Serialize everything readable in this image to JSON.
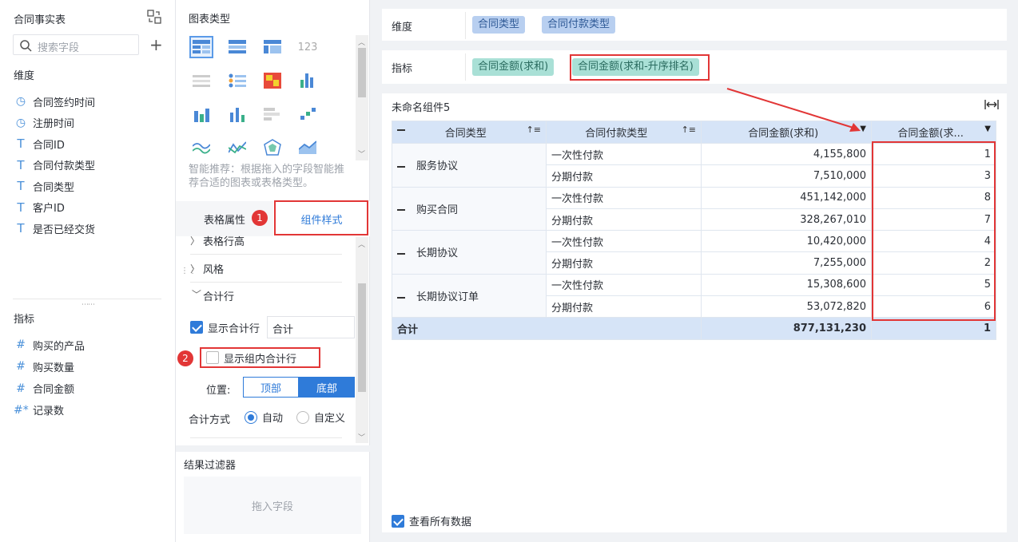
{
  "left": {
    "title": "合同事实表",
    "search_placeholder": "搜索字段",
    "dim_header": "维度",
    "dimensions": [
      {
        "icon": "clock-icon",
        "label": "合同签约时间"
      },
      {
        "icon": "clock-icon",
        "label": "注册时间"
      },
      {
        "icon": "text-icon",
        "label": "合同ID"
      },
      {
        "icon": "text-icon",
        "label": "合同付款类型"
      },
      {
        "icon": "text-icon",
        "label": "合同类型"
      },
      {
        "icon": "text-icon",
        "label": "客户ID"
      },
      {
        "icon": "text-icon",
        "label": "是否已经交货"
      }
    ],
    "met_header": "指标",
    "metrics": [
      {
        "icon": "hash-icon",
        "label": "购买的产品"
      },
      {
        "icon": "hash-icon",
        "label": "购买数量"
      },
      {
        "icon": "hash-icon",
        "label": "合同金额"
      },
      {
        "icon": "hash-star-icon",
        "label": "记录数"
      }
    ]
  },
  "mid": {
    "chart_type_title": "图表类型",
    "smart_hint": "智能推荐：根据拖入的字段智能推荐合适的图表或表格类型。",
    "tab_table_props": "表格属性",
    "tab_component_style": "组件样式",
    "badge1": "1",
    "badge2": "2",
    "row_height": "表格行高",
    "style": "风格",
    "total_row": "合计行",
    "show_total": "显示合计行",
    "total_name": "合计",
    "show_group_total": "显示组内合计行",
    "position_label": "位置:",
    "pos_top": "顶部",
    "pos_bottom": "底部",
    "total_method_label": "合计方式",
    "auto": "自动",
    "custom": "自定义",
    "result_filter": "结果过滤器",
    "drag_field": "拖入字段"
  },
  "right": {
    "dim_label": "维度",
    "dim_pills": [
      "合同类型",
      "合同付款类型"
    ],
    "met_label": "指标",
    "met_pills": [
      "合同金额(求和)",
      "合同金额(求和-升序排名)"
    ],
    "component_title": "未命名组件5",
    "view_all": "查看所有数据",
    "table": {
      "headers": [
        "合同类型",
        "合同付款类型",
        "合同金额(求和)",
        "合同金额(求..."
      ],
      "groups": [
        {
          "name": "服务协议",
          "rows": [
            [
              "一次性付款",
              "4,155,800",
              "1"
            ],
            [
              "分期付款",
              "7,510,000",
              "3"
            ]
          ]
        },
        {
          "name": "购买合同",
          "rows": [
            [
              "一次性付款",
              "451,142,000",
              "8"
            ],
            [
              "分期付款",
              "328,267,010",
              "7"
            ]
          ]
        },
        {
          "name": "长期协议",
          "rows": [
            [
              "一次性付款",
              "10,420,000",
              "4"
            ],
            [
              "分期付款",
              "7,255,000",
              "2"
            ]
          ]
        },
        {
          "name": "长期协议订单",
          "rows": [
            [
              "一次性付款",
              "15,308,600",
              "5"
            ],
            [
              "分期付款",
              "53,072,820",
              "6"
            ]
          ]
        }
      ],
      "total": {
        "label": "合计",
        "sum": "877,131,230",
        "rank": "1"
      }
    }
  }
}
